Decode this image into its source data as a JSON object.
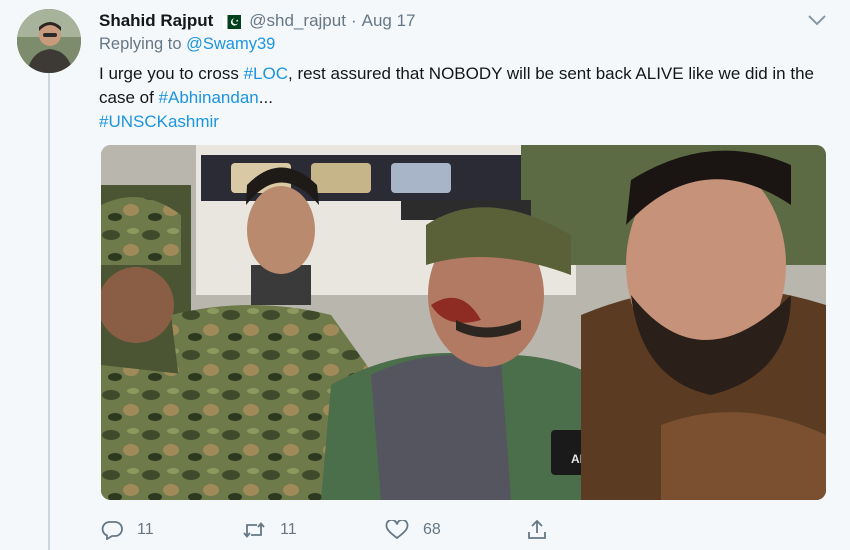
{
  "tweet": {
    "author_name": "Shahid Rajput",
    "handle": "@shd_rajput",
    "separator": "·",
    "date": "Aug 17",
    "flag_icon": "pakistan-flag-icon",
    "replying_label": "Replying to ",
    "replying_to": "@Swamy39",
    "text": {
      "part1": "I urge you to cross ",
      "hashtag1": "#LOC",
      "part2": ", rest assured that NOBODY will be sent back ALIVE like we did in the case of ",
      "hashtag2": "#Abhinandan",
      "part3": "...",
      "hashtag3": "#UNSCKashmir"
    },
    "media_patch_text": "ABHI"
  },
  "actions": {
    "reply_count": "11",
    "retweet_count": "11",
    "like_count": "68"
  },
  "colors": {
    "link": "#1b95e0",
    "muted": "#657786",
    "background": "#f5f8fa",
    "flag_green": "#01411c"
  }
}
